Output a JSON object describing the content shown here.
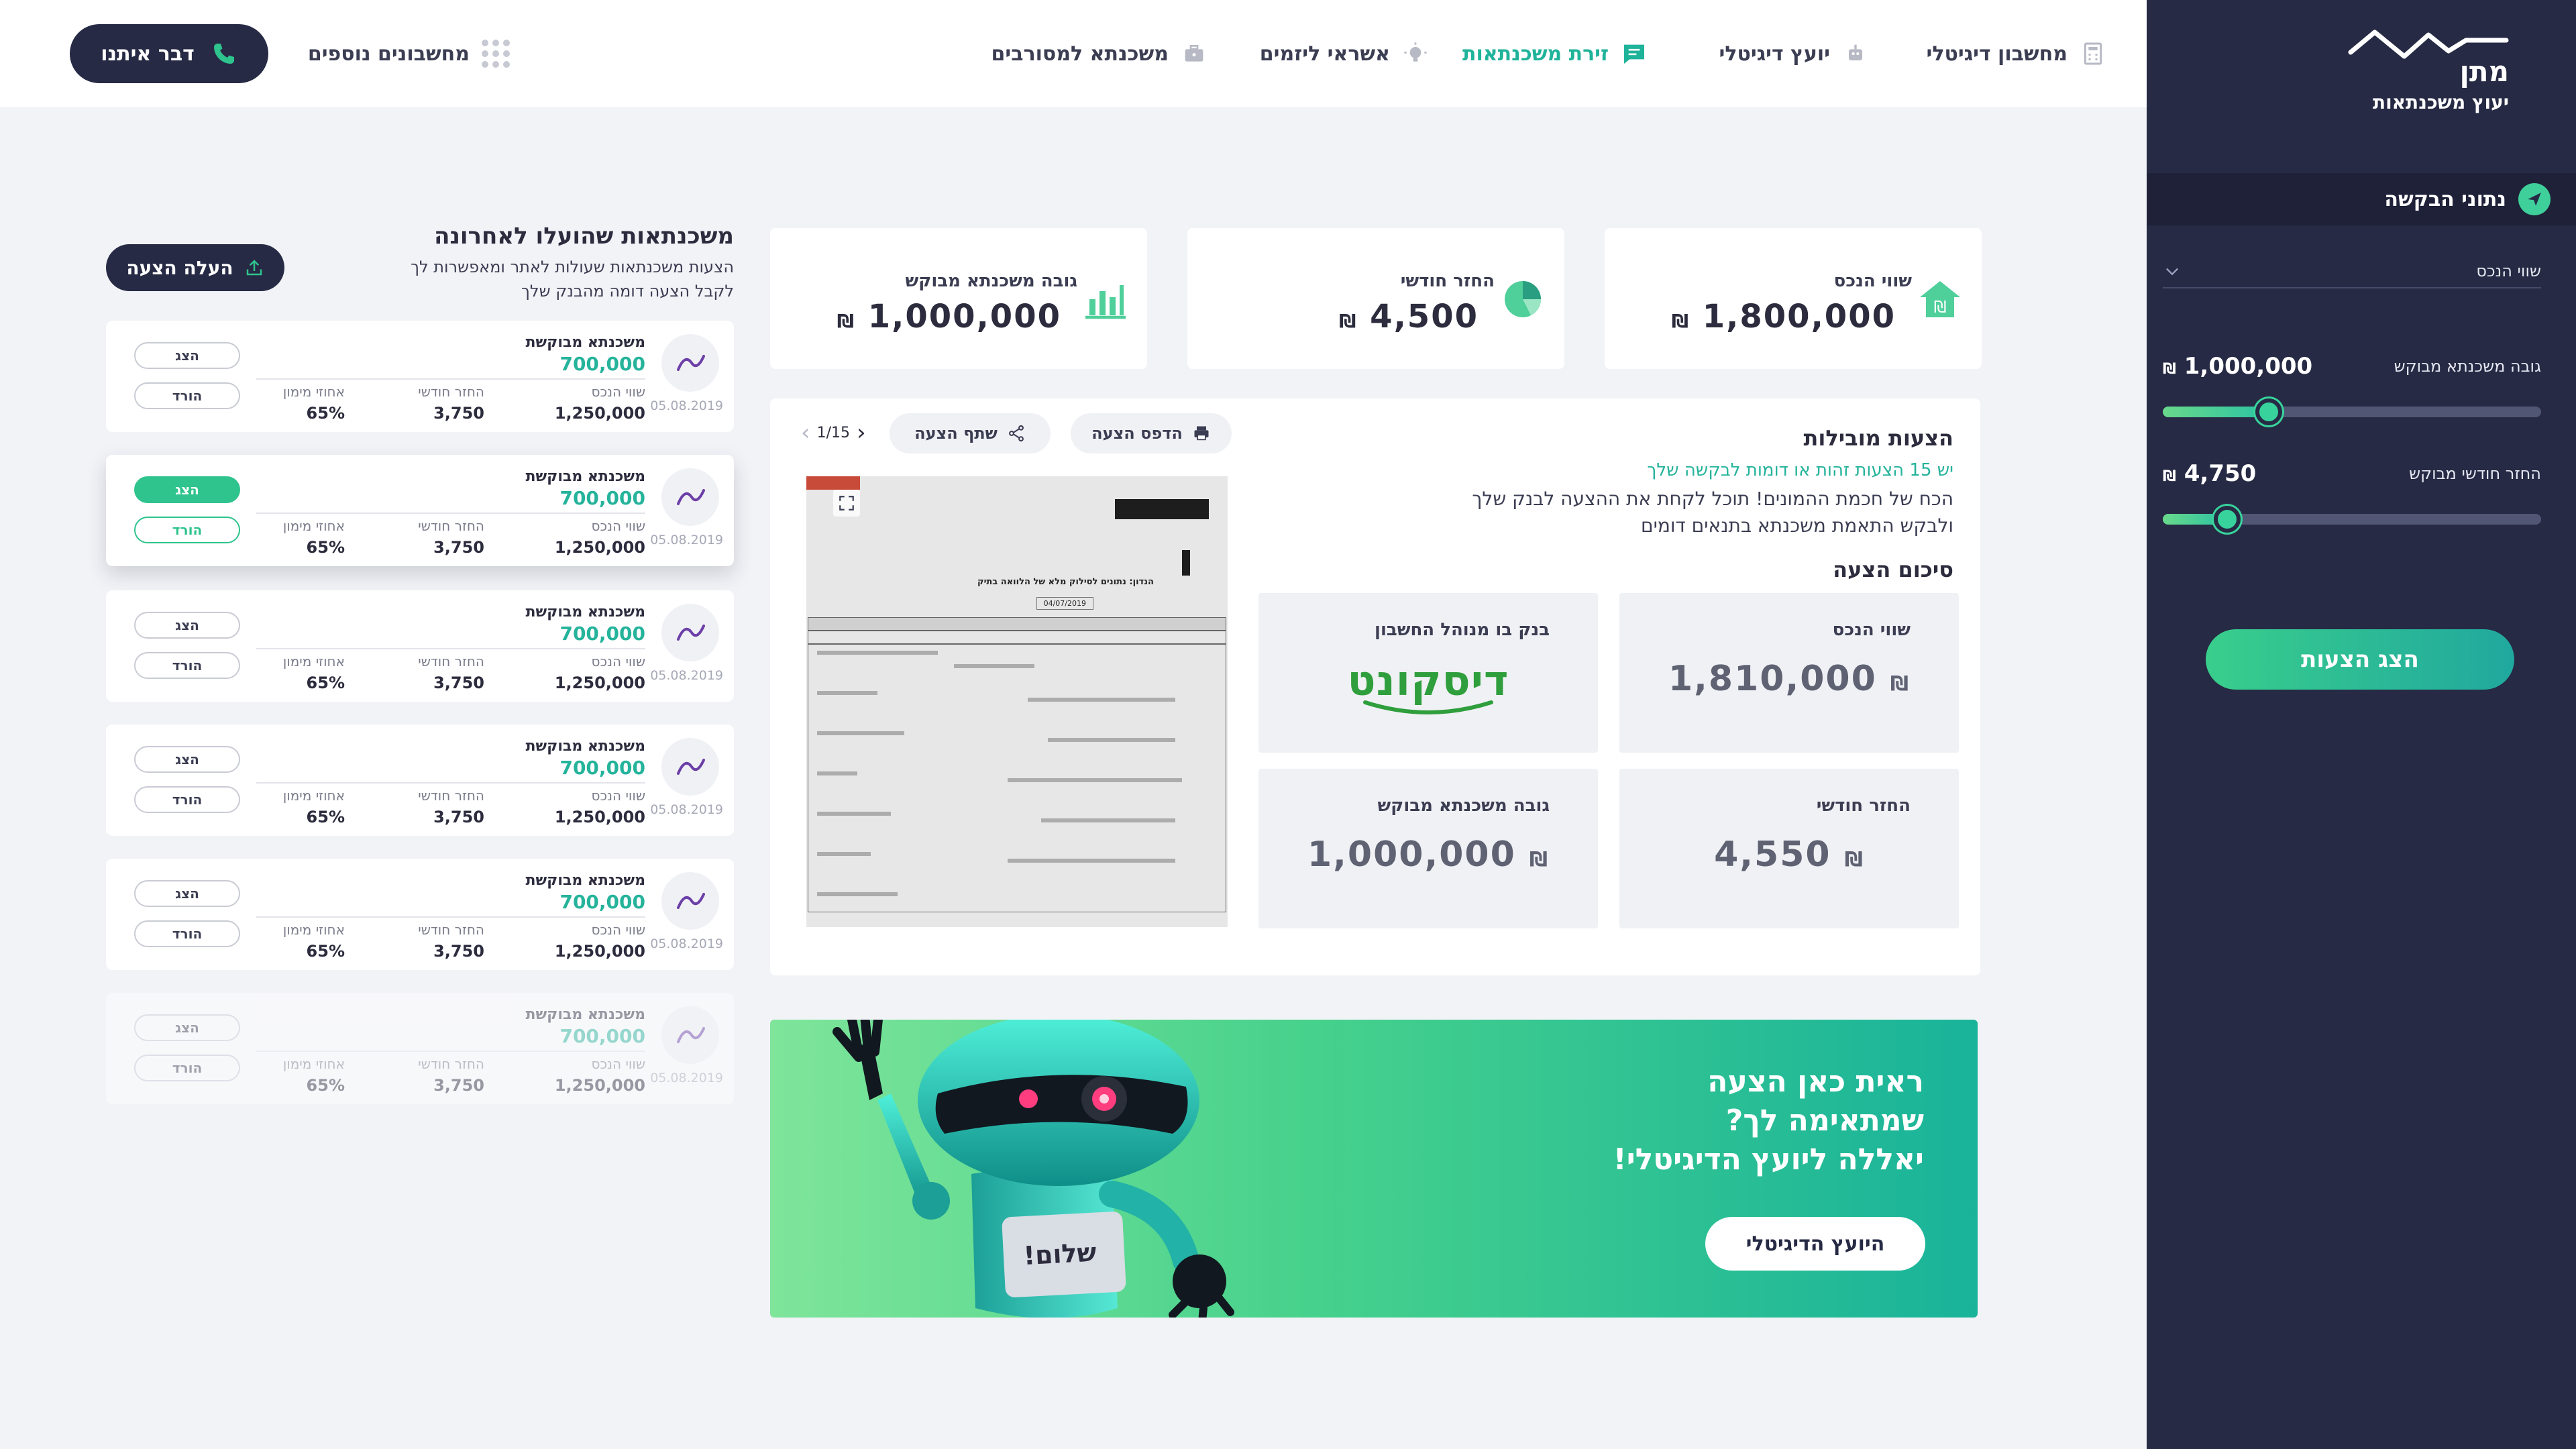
{
  "sidebar": {
    "brand_name": "מתן",
    "brand_sub": "יעוץ משכנתאות",
    "section_title": "נתוני הבקשה",
    "property_select": "שווי הנכס",
    "loan": {
      "label": "גובה משכנתא מבוקש",
      "value": "1,000,000",
      "currency": "₪",
      "level": 0.28
    },
    "monthly": {
      "label": "החזר חודשי מבוקש",
      "value": "4,750",
      "currency": "₪",
      "level": 0.17
    },
    "cta": "הצג הצעות"
  },
  "nav": {
    "items": [
      {
        "label": "מחשבון דיגיטלי",
        "icon": "calculator-icon",
        "active": false
      },
      {
        "label": "יועץ דיגיטלי",
        "icon": "robot-icon",
        "active": false
      },
      {
        "label": "זירת משכנתאות",
        "icon": "chat-list-icon",
        "active": true
      },
      {
        "label": "אשראי ליזמים",
        "icon": "lightbulb-icon",
        "active": false
      },
      {
        "label": "משכנתא למסורבים",
        "icon": "briefcase-icon",
        "active": false
      }
    ],
    "more": "מחשבונים נוספים",
    "talk": "דבר איתנו"
  },
  "stats": [
    {
      "label": "שווי הנכס",
      "value": "1,800,000",
      "currency": "₪",
      "icon": "house-shekel-icon"
    },
    {
      "label": "החזר חודשי",
      "value": "4,500",
      "currency": "₪",
      "icon": "pie-chart-icon"
    },
    {
      "label": "גובה משכנתא מבוקש",
      "value": "1,000,000",
      "currency": "₪",
      "icon": "bar-chart-icon"
    }
  ],
  "offers": {
    "title": "הצעות מובילות",
    "subtitle": "יש 15 הצעות זהות או דומות לבקשה שלך",
    "desc": "הכח של חכמת ההמונים! תוכל לקחת את ההצעה לבנק שלך ולבקש התאמת משכנתא בתנאים דומים",
    "summary_title": "סיכום הצעה",
    "print": "הדפס הצעה",
    "share": "שתף הצעה",
    "pager": "1/15",
    "boxes": {
      "property_label": "שווי הנכס",
      "property_value": "1,810,000",
      "bank_label": "בנק בו מנוהל החשבון",
      "bank_name": "דיסקונט",
      "monthly_label": "החזר חודשי",
      "monthly_value": "4,550",
      "loan_label": "גובה משכנתא מבוקש",
      "loan_value": "1,000,000",
      "currency": "₪"
    },
    "doc": {
      "head": "הנדון: נתונים לסילוק מלא של הלוואה בתיק",
      "date": "04/07/2019"
    }
  },
  "banner": {
    "line1": "ראית כאן הצעה",
    "line2": "שמתאימה לך?",
    "line3": "יאללה ליועץ הדיגיטלי!",
    "cta": "היועץ הדיגיטלי",
    "robot_screen": "שלום!"
  },
  "recent": {
    "title": "משכנתאות שהועלו לאחרונה",
    "desc": "הצעות משכנתאות שעולות לאתר ומאפשרות לך לקבל הצעה דומה מהבנק שלך",
    "upload": "העלה הצעה",
    "items": [
      {
        "title": "משכנתא מבוקשת",
        "amount": "700,000",
        "date": "05.08.2019",
        "property_label": "שווי הנכס",
        "property": "1,250,000",
        "monthly_label": "החזר חודשי",
        "monthly": "3,750",
        "ltv_label": "אחוזי מימון",
        "ltv": "65%",
        "show": "הצג",
        "download": "הורד"
      },
      {
        "title": "משכנתא מבוקשת",
        "amount": "700,000",
        "date": "05.08.2019",
        "property_label": "שווי הנכס",
        "property": "1,250,000",
        "monthly_label": "החזר חודשי",
        "monthly": "3,750",
        "ltv_label": "אחוזי מימון",
        "ltv": "65%",
        "show": "הצג",
        "download": "הורד"
      },
      {
        "title": "משכנתא מבוקשת",
        "amount": "700,000",
        "date": "05.08.2019",
        "property_label": "שווי הנכס",
        "property": "1,250,000",
        "monthly_label": "החזר חודשי",
        "monthly": "3,750",
        "ltv_label": "אחוזי מימון",
        "ltv": "65%",
        "show": "הצג",
        "download": "הורד"
      },
      {
        "title": "משכנתא מבוקשת",
        "amount": "700,000",
        "date": "05.08.2019",
        "property_label": "שווי הנכס",
        "property": "1,250,000",
        "monthly_label": "החזר חודשי",
        "monthly": "3,750",
        "ltv_label": "אחוזי מימון",
        "ltv": "65%",
        "show": "הצג",
        "download": "הורד"
      },
      {
        "title": "משכנתא מבוקשת",
        "amount": "700,000",
        "date": "05.08.2019",
        "property_label": "שווי הנכס",
        "property": "1,250,000",
        "monthly_label": "החזר חודשי",
        "monthly": "3,750",
        "ltv_label": "אחוזי מימון",
        "ltv": "65%",
        "show": "הצג",
        "download": "הורד"
      },
      {
        "title": "משכנתא מבוקשת",
        "amount": "700,000",
        "date": "05.08.2019",
        "property_label": "שווי הנכס",
        "property": "1,250,000",
        "monthly_label": "החזר חודשי",
        "monthly": "3,750",
        "ltv_label": "אחוזי מימון",
        "ltv": "65%",
        "show": "הצג",
        "download": "הורד"
      }
    ]
  },
  "colors": {
    "navy": "#262a44",
    "accent": "#2fc38d",
    "teal": "#1fb39a"
  }
}
